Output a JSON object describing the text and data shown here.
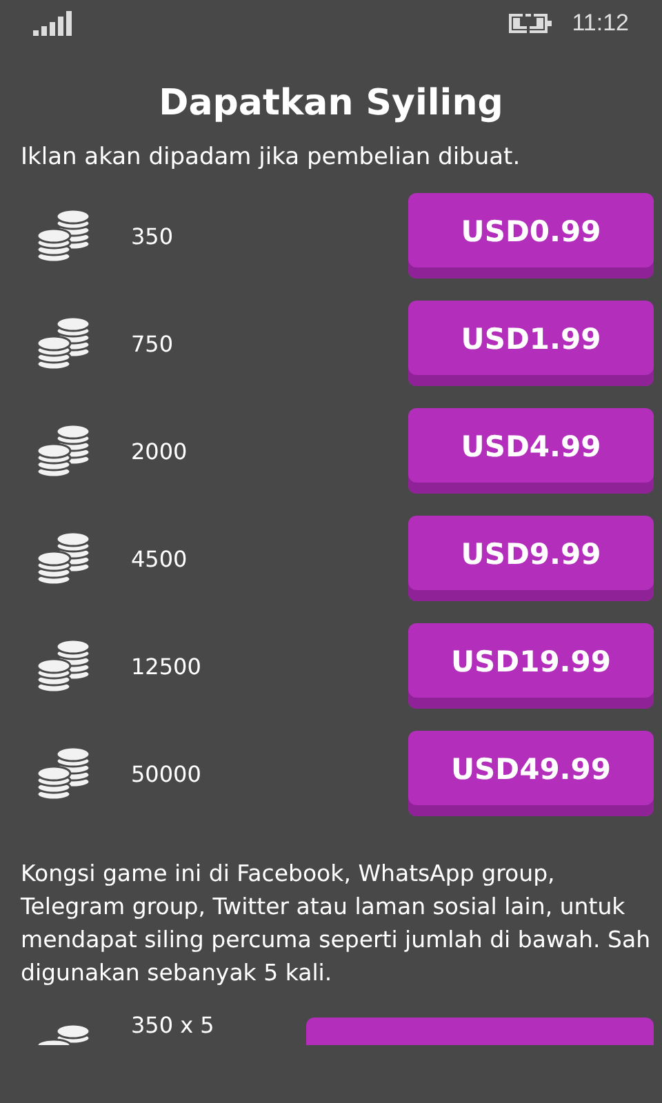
{
  "status_bar": {
    "time": "11:12"
  },
  "title": "Dapatkan Syiling",
  "subtitle": "Iklan akan dipadam jika pembelian dibuat.",
  "packages": [
    {
      "amount": "350",
      "price": "USD0.99"
    },
    {
      "amount": "750",
      "price": "USD1.99"
    },
    {
      "amount": "2000",
      "price": "USD4.99"
    },
    {
      "amount": "4500",
      "price": "USD9.99"
    },
    {
      "amount": "12500",
      "price": "USD19.99"
    },
    {
      "amount": "50000",
      "price": "USD49.99"
    }
  ],
  "share_text": "Kongsi game ini di Facebook, WhatsApp group, Telegram group, Twitter atau laman sosial lain, untuk mendapat siling percuma seperti jumlah di bawah. Sah digunakan sebanyak 5 kali.",
  "share_offer": {
    "amount": "350 x 5"
  }
}
